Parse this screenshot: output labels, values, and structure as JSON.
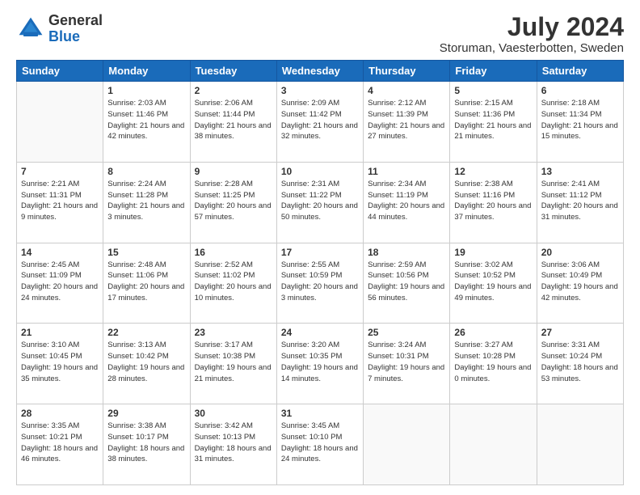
{
  "header": {
    "logo_general": "General",
    "logo_blue": "Blue",
    "month_year": "July 2024",
    "location": "Storuman, Vaesterbotten, Sweden"
  },
  "weekdays": [
    "Sunday",
    "Monday",
    "Tuesday",
    "Wednesday",
    "Thursday",
    "Friday",
    "Saturday"
  ],
  "weeks": [
    [
      {
        "day": "",
        "info": ""
      },
      {
        "day": "1",
        "info": "Sunrise: 2:03 AM\nSunset: 11:46 PM\nDaylight: 21 hours\nand 42 minutes."
      },
      {
        "day": "2",
        "info": "Sunrise: 2:06 AM\nSunset: 11:44 PM\nDaylight: 21 hours\nand 38 minutes."
      },
      {
        "day": "3",
        "info": "Sunrise: 2:09 AM\nSunset: 11:42 PM\nDaylight: 21 hours\nand 32 minutes."
      },
      {
        "day": "4",
        "info": "Sunrise: 2:12 AM\nSunset: 11:39 PM\nDaylight: 21 hours\nand 27 minutes."
      },
      {
        "day": "5",
        "info": "Sunrise: 2:15 AM\nSunset: 11:36 PM\nDaylight: 21 hours\nand 21 minutes."
      },
      {
        "day": "6",
        "info": "Sunrise: 2:18 AM\nSunset: 11:34 PM\nDaylight: 21 hours\nand 15 minutes."
      }
    ],
    [
      {
        "day": "7",
        "info": "Sunrise: 2:21 AM\nSunset: 11:31 PM\nDaylight: 21 hours\nand 9 minutes."
      },
      {
        "day": "8",
        "info": "Sunrise: 2:24 AM\nSunset: 11:28 PM\nDaylight: 21 hours\nand 3 minutes."
      },
      {
        "day": "9",
        "info": "Sunrise: 2:28 AM\nSunset: 11:25 PM\nDaylight: 20 hours\nand 57 minutes."
      },
      {
        "day": "10",
        "info": "Sunrise: 2:31 AM\nSunset: 11:22 PM\nDaylight: 20 hours\nand 50 minutes."
      },
      {
        "day": "11",
        "info": "Sunrise: 2:34 AM\nSunset: 11:19 PM\nDaylight: 20 hours\nand 44 minutes."
      },
      {
        "day": "12",
        "info": "Sunrise: 2:38 AM\nSunset: 11:16 PM\nDaylight: 20 hours\nand 37 minutes."
      },
      {
        "day": "13",
        "info": "Sunrise: 2:41 AM\nSunset: 11:12 PM\nDaylight: 20 hours\nand 31 minutes."
      }
    ],
    [
      {
        "day": "14",
        "info": "Sunrise: 2:45 AM\nSunset: 11:09 PM\nDaylight: 20 hours\nand 24 minutes."
      },
      {
        "day": "15",
        "info": "Sunrise: 2:48 AM\nSunset: 11:06 PM\nDaylight: 20 hours\nand 17 minutes."
      },
      {
        "day": "16",
        "info": "Sunrise: 2:52 AM\nSunset: 11:02 PM\nDaylight: 20 hours\nand 10 minutes."
      },
      {
        "day": "17",
        "info": "Sunrise: 2:55 AM\nSunset: 10:59 PM\nDaylight: 20 hours\nand 3 minutes."
      },
      {
        "day": "18",
        "info": "Sunrise: 2:59 AM\nSunset: 10:56 PM\nDaylight: 19 hours\nand 56 minutes."
      },
      {
        "day": "19",
        "info": "Sunrise: 3:02 AM\nSunset: 10:52 PM\nDaylight: 19 hours\nand 49 minutes."
      },
      {
        "day": "20",
        "info": "Sunrise: 3:06 AM\nSunset: 10:49 PM\nDaylight: 19 hours\nand 42 minutes."
      }
    ],
    [
      {
        "day": "21",
        "info": "Sunrise: 3:10 AM\nSunset: 10:45 PM\nDaylight: 19 hours\nand 35 minutes."
      },
      {
        "day": "22",
        "info": "Sunrise: 3:13 AM\nSunset: 10:42 PM\nDaylight: 19 hours\nand 28 minutes."
      },
      {
        "day": "23",
        "info": "Sunrise: 3:17 AM\nSunset: 10:38 PM\nDaylight: 19 hours\nand 21 minutes."
      },
      {
        "day": "24",
        "info": "Sunrise: 3:20 AM\nSunset: 10:35 PM\nDaylight: 19 hours\nand 14 minutes."
      },
      {
        "day": "25",
        "info": "Sunrise: 3:24 AM\nSunset: 10:31 PM\nDaylight: 19 hours\nand 7 minutes."
      },
      {
        "day": "26",
        "info": "Sunrise: 3:27 AM\nSunset: 10:28 PM\nDaylight: 19 hours\nand 0 minutes."
      },
      {
        "day": "27",
        "info": "Sunrise: 3:31 AM\nSunset: 10:24 PM\nDaylight: 18 hours\nand 53 minutes."
      }
    ],
    [
      {
        "day": "28",
        "info": "Sunrise: 3:35 AM\nSunset: 10:21 PM\nDaylight: 18 hours\nand 46 minutes."
      },
      {
        "day": "29",
        "info": "Sunrise: 3:38 AM\nSunset: 10:17 PM\nDaylight: 18 hours\nand 38 minutes."
      },
      {
        "day": "30",
        "info": "Sunrise: 3:42 AM\nSunset: 10:13 PM\nDaylight: 18 hours\nand 31 minutes."
      },
      {
        "day": "31",
        "info": "Sunrise: 3:45 AM\nSunset: 10:10 PM\nDaylight: 18 hours\nand 24 minutes."
      },
      {
        "day": "",
        "info": ""
      },
      {
        "day": "",
        "info": ""
      },
      {
        "day": "",
        "info": ""
      }
    ]
  ]
}
